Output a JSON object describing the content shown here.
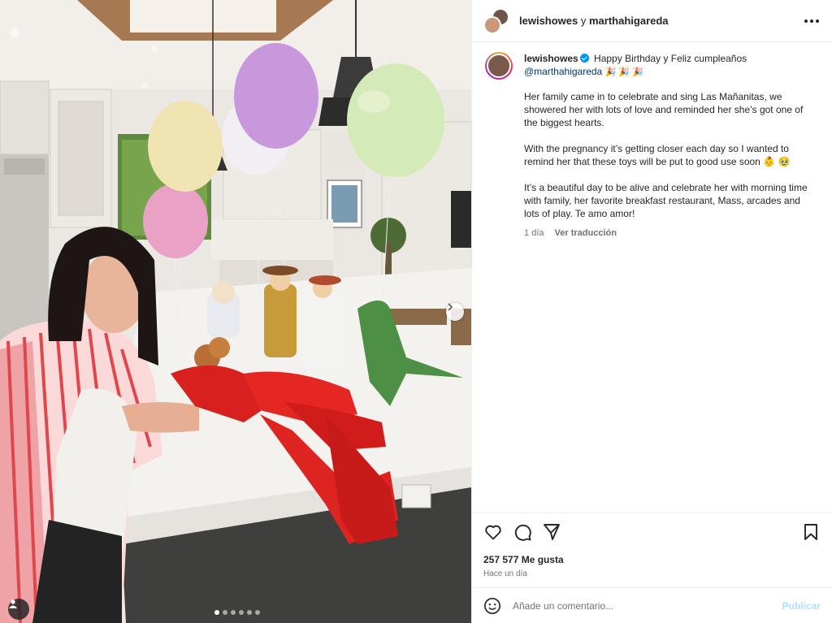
{
  "header": {
    "account_1": "lewishowes",
    "separator": "y",
    "account_2": "marthahigareda"
  },
  "caption": {
    "username": "lewishowes",
    "intro": "Happy Birthday y Feliz cumpleaños",
    "mention": "@marthahigareda",
    "intro_emojis": "🎉 🎉 🎉",
    "paragraphs": [
      "Her family came in to celebrate and sing Las Mañanitas, we showered her with lots of love and reminded her she’s got one of the biggest hearts.",
      "With the pregnancy it’s getting closer each day so I wanted to remind her that these toys will be put to good use soon 👶 🥹",
      "It’s a beautiful day to be alive and celebrate her with morning time with family, her favorite breakfast restaurant, Mass, arcades and lots of play. Te amo amor!"
    ],
    "time": "1 día",
    "translate": "Ver traducción"
  },
  "actions": {
    "likes": "257 577 Me gusta",
    "posted": "Hace un día"
  },
  "comment": {
    "placeholder": "Añade un comentario...",
    "publish": "Publicar"
  },
  "icons": [
    "heart-icon",
    "comment-icon",
    "share-icon",
    "bookmark-icon",
    "emoji-icon",
    "more-icon",
    "user-tag-icon",
    "chevron-right-icon"
  ],
  "colors": {
    "accent": "#0095f6",
    "publish_disabled": "#b2dffc",
    "mention": "#00376b",
    "muted": "#737373"
  },
  "carousel": {
    "count": 6,
    "active": 1
  }
}
